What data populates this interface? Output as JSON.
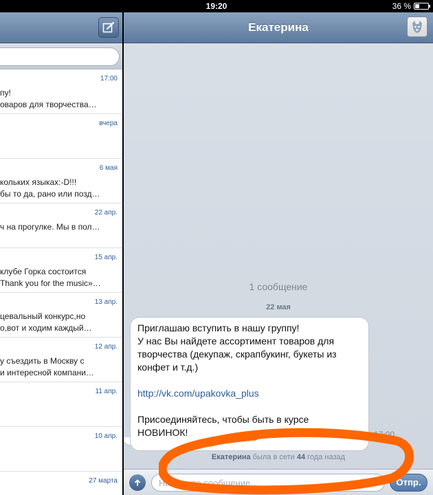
{
  "status_bar": {
    "time": "19:20",
    "battery": "36 %",
    "battery_level": 0.36
  },
  "left_pane": {
    "dialogs": [
      {
        "time": "17:00",
        "line1": "пу!",
        "line2": "оваров для творчества…"
      },
      {
        "time": "вчера",
        "line1": "",
        "line2": ""
      },
      {
        "time": "6 мая",
        "line1": "кольких языках:-D!!!",
        "line2": "бы то да, рано или позд…"
      },
      {
        "time": "22 апр.",
        "line1": "ч на прогулке. Мы в пол…",
        "line2": ""
      },
      {
        "time": "15 апр.",
        "line1": "клубе Горка состоится",
        "line2": "Thank you for the music»…"
      },
      {
        "time": "13 апр.",
        "line1": "цевальный конкурс,но",
        "line2": "о,вот и ходим каждый…"
      },
      {
        "time": "12 апр.",
        "line1": "у съездить в Москву с",
        "line2": "и интересной компани…"
      },
      {
        "time": "11 апр.",
        "line1": "",
        "line2": ""
      },
      {
        "time": "10 апр.",
        "line1": "",
        "line2": ""
      },
      {
        "time": "27 марта",
        "line1": "",
        "line2": ""
      }
    ]
  },
  "chat": {
    "title": "Екатерина",
    "message_count": "1 сообщение",
    "date": "22 мая",
    "message": {
      "lines": [
        "Приглашаю вступить в нашу группу!",
        "У нас Вы найдете ассортимент товаров для",
        "творчества (декупаж, скрапбукинг, букеты из",
        "конфет и т.д.)"
      ],
      "link": "http://vk.com/upakovka_plus",
      "closing": [
        "Присоединяйтесь, чтобы быть в курсе",
        "НОВИНОК!"
      ],
      "time": "17:00"
    },
    "online_status": {
      "name": "Екатерина",
      "text1": " была в сети ",
      "number": "44",
      "text2": " года назад"
    },
    "input": {
      "placeholder": "Напишите сообщение"
    },
    "send_label": "Отпр."
  },
  "colors": {
    "nav_bar": "#6f8aad",
    "link": "#2b5d9a",
    "annotation": "#ff6600"
  },
  "icons": {
    "compose": "compose-icon",
    "avatar": "vk-dog-avatar-icon",
    "attach": "upload-arrow-icon"
  }
}
